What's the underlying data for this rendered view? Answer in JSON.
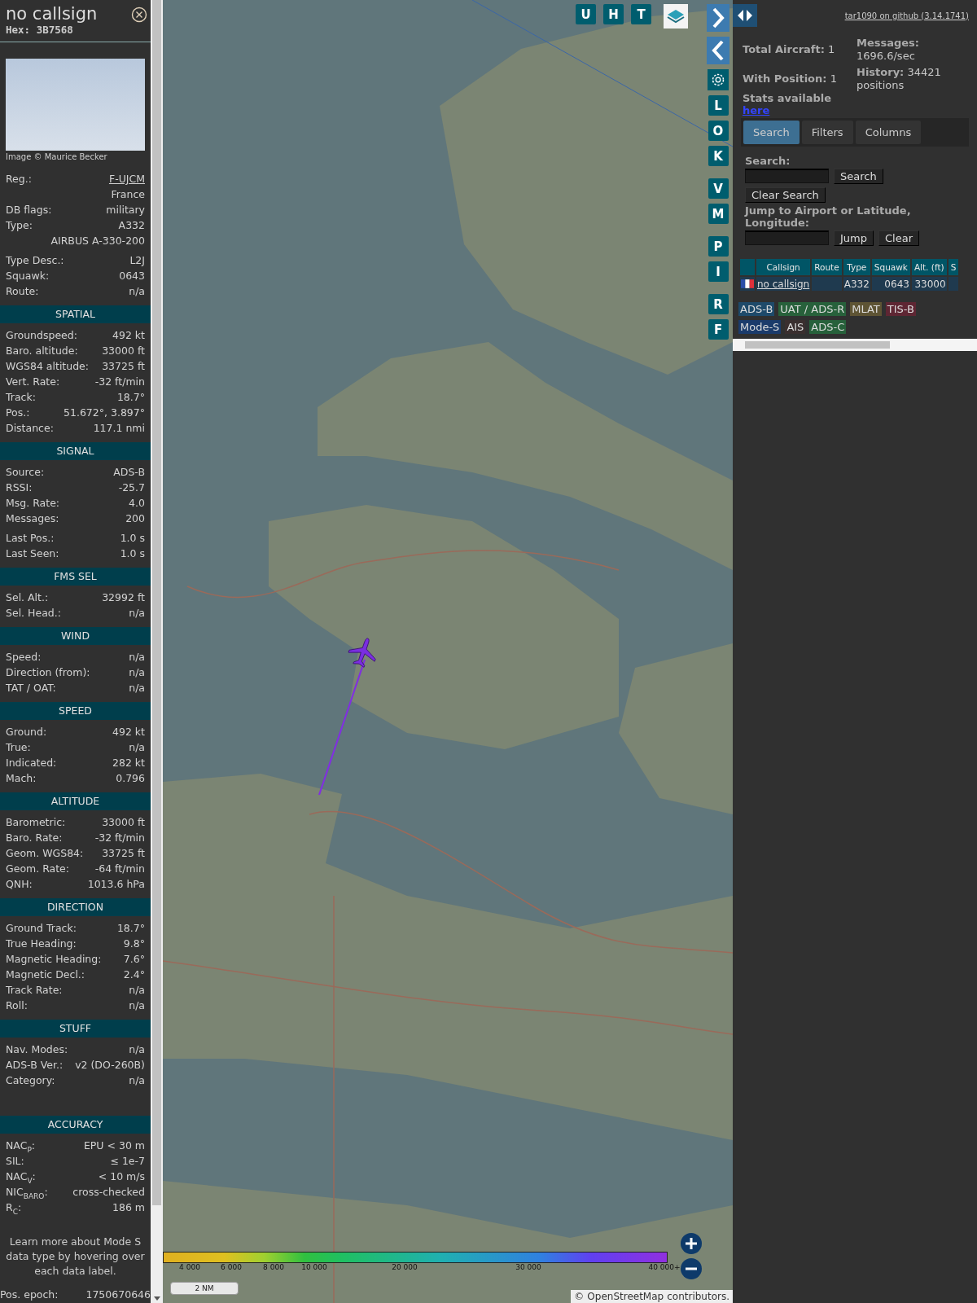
{
  "aircraft": {
    "callsign": "no callsign",
    "hex": "Hex: 3B7568",
    "photo_credit": "Image © Maurice Becker"
  },
  "details": [
    [
      {
        "label": "Reg.:",
        "value": "F-UJCM",
        "link": true
      },
      {
        "value": "France"
      },
      {
        "label": "DB flags:",
        "value": "military"
      },
      {
        "label": "Type:",
        "value": "A332"
      },
      {
        "value": "AIRBUS A-330-200"
      }
    ],
    [
      {
        "label": "Type Desc.:",
        "value": "L2J"
      },
      {
        "label": "Squawk:",
        "value": "0643"
      },
      {
        "label": "Route:",
        "value": "n/a"
      }
    ]
  ],
  "sections": [
    {
      "title": "SPATIAL",
      "groups": [
        [
          {
            "label": "Groundspeed:",
            "value": "492 kt"
          },
          {
            "label": "Baro. altitude:",
            "value": "33000 ft"
          },
          {
            "label": "WGS84 altitude:",
            "value": "33725 ft"
          },
          {
            "label": "Vert. Rate:",
            "value": "-32 ft/min"
          },
          {
            "label": "Track:",
            "value": "18.7°"
          },
          {
            "label": "Pos.:",
            "value": "51.672°, 3.897°"
          },
          {
            "label": "Distance:",
            "value": "117.1 nmi"
          }
        ]
      ]
    },
    {
      "title": "SIGNAL",
      "groups": [
        [
          {
            "label": "Source:",
            "value": "ADS-B"
          },
          {
            "label": "RSSI:",
            "value": "-25.7"
          },
          {
            "label": "Msg. Rate:",
            "value": "4.0"
          },
          {
            "label": "Messages:",
            "value": "200"
          }
        ],
        [
          {
            "label": "Last Pos.:",
            "value": "1.0 s"
          },
          {
            "label": "Last Seen:",
            "value": "1.0 s"
          }
        ]
      ]
    },
    {
      "title": "FMS SEL",
      "groups": [
        [
          {
            "label": "Sel. Alt.:",
            "value": "32992 ft"
          },
          {
            "label": "Sel. Head.:",
            "value": "n/a"
          }
        ]
      ]
    },
    {
      "title": "WIND",
      "groups": [
        [
          {
            "label": "Speed:",
            "value": "n/a"
          },
          {
            "label": "Direction (from):",
            "value": "n/a"
          },
          {
            "label": "TAT / OAT:",
            "value": "n/a"
          }
        ]
      ]
    },
    {
      "title": "SPEED",
      "groups": [
        [
          {
            "label": "Ground:",
            "value": "492 kt"
          },
          {
            "label": "True:",
            "value": "n/a"
          },
          {
            "label": "Indicated:",
            "value": "282 kt"
          },
          {
            "label": "Mach:",
            "value": "0.796"
          }
        ]
      ]
    },
    {
      "title": "ALTITUDE",
      "groups": [
        [
          {
            "label": "Barometric:",
            "value": "33000 ft"
          },
          {
            "label": "Baro. Rate:",
            "value": "-32 ft/min"
          },
          {
            "label": "Geom. WGS84:",
            "value": "33725 ft"
          },
          {
            "label": "Geom. Rate:",
            "value": "-64 ft/min"
          },
          {
            "label": "QNH:",
            "value": "1013.6 hPa"
          }
        ]
      ]
    },
    {
      "title": "DIRECTION",
      "groups": [
        [
          {
            "label": "Ground Track:",
            "value": "18.7°"
          },
          {
            "label": "True Heading:",
            "value": "9.8°"
          },
          {
            "label": "Magnetic Heading:",
            "value": "7.6°"
          },
          {
            "label": "Magnetic Decl.:",
            "value": "2.4°"
          },
          {
            "label": "Track Rate:",
            "value": "n/a"
          },
          {
            "label": "Roll:",
            "value": "n/a"
          }
        ]
      ]
    },
    {
      "title": "STUFF",
      "groups": [
        [
          {
            "label": "Nav. Modes:",
            "value": "n/a"
          },
          {
            "label": "ADS-B Ver.:",
            "value": "v2 (DO-260B)"
          },
          {
            "label": "Category:",
            "value": "n/a"
          }
        ]
      ]
    },
    {
      "title": "ACCURACY",
      "groups": [
        [
          {
            "label": "NAC$_{P}$:",
            "value": "EPU < 30 m"
          },
          {
            "label": "SIL:",
            "value": "≤ 1e-7"
          },
          {
            "label": "NAC$_{V}$:",
            "value": "< 10 m/s"
          },
          {
            "label": "NIC$_{BARO}$:",
            "value": "cross-checked"
          },
          {
            "label": "R$_{C}$:",
            "value": "186 m"
          }
        ]
      ]
    }
  ],
  "note": "Learn more about Mode S data type by hovering over each data label.",
  "epoch": {
    "label": "Pos. epoch:",
    "value": "1750670646"
  },
  "map_toolbar": {
    "top": [
      "U",
      "H",
      "T"
    ],
    "side_groups": [
      [
        "L",
        "O",
        "K"
      ],
      [
        "V",
        "M"
      ],
      [
        "P",
        "I"
      ],
      [
        "R",
        "F"
      ]
    ]
  },
  "altitude_legend": [
    "4 000",
    "6 000",
    "8 000",
    "10 000",
    "20 000",
    "30 000",
    "40 000+"
  ],
  "scale": "2 NM",
  "attribution": {
    "prefix": "©",
    "link": "OpenStreetMap",
    "suffix": "contributors."
  },
  "github_link": "tar1090 on github (3.14.1741)",
  "stats": [
    {
      "text": "**Total Aircraft:** 1"
    },
    {
      "text": "**With Position:** 1"
    },
    {
      "text": "**Messages:** 1696.6/sec"
    },
    {
      "text": "**History:** 34421 positions"
    }
  ],
  "stats_link": {
    "text": "Stats available",
    "link": "here"
  },
  "tabs": [
    {
      "label": "Search",
      "selected": true
    },
    {
      "label": "Filters",
      "selected": false
    },
    {
      "label": "Columns",
      "selected": false
    }
  ],
  "search": {
    "label": "Search:",
    "button": "Search",
    "clear_button": "Clear Search",
    "jump_label": "Jump to Airport or Latitude, Longitude:",
    "jump_button": "Jump",
    "jump_clear_button": "Clear"
  },
  "table": {
    "columns": [
      "Callsign",
      "Route",
      "Type",
      "Squawk",
      "Alt. (ft)",
      "S"
    ],
    "rows": [
      {
        "cells": [
          "no callsign",
          null,
          "A332",
          "0643",
          "33000",
          null
        ]
      }
    ]
  },
  "source_legend": [
    {
      "label": "ADS-B",
      "color": "#1e4a6a"
    },
    {
      "label": "UAT / ADS-R",
      "color": "#27613b"
    },
    {
      "label": "MLAT",
      "color": "#5e5434"
    },
    {
      "label": "TIS-B",
      "color": "#5e2633"
    },
    {
      "label": "Mode-S",
      "color": "#1b3b6b"
    },
    {
      "label": "AIS",
      "color": "#3a2f2f"
    },
    {
      "label": "ADS-C",
      "color": "#27613b"
    }
  ]
}
